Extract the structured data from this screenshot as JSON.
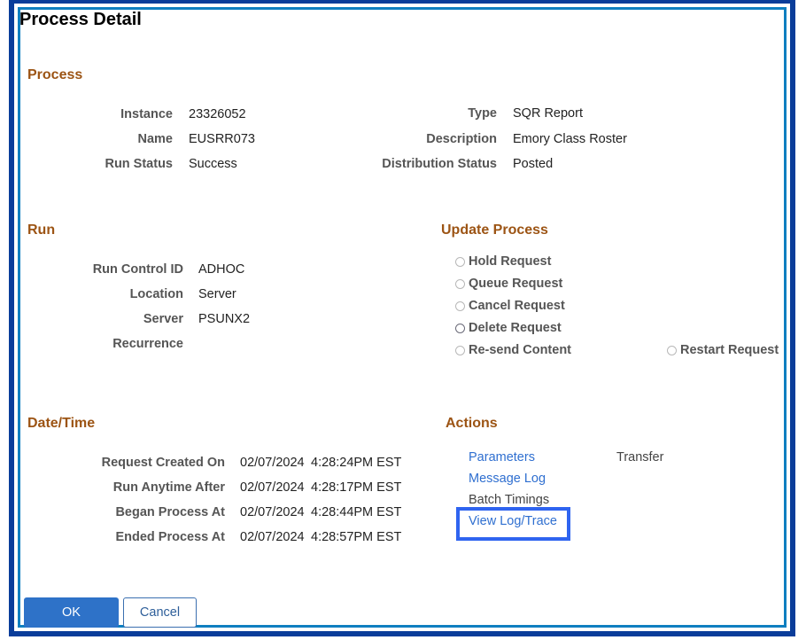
{
  "page": {
    "title": "Process Detail"
  },
  "process": {
    "heading": "Process",
    "fields": [
      {
        "label": "Instance",
        "value": "23326052"
      },
      {
        "label": "Name",
        "value": "EUSRR073"
      },
      {
        "label": "Run Status",
        "value": "Success"
      }
    ],
    "fields_right": [
      {
        "label": "Type",
        "value": "SQR Report"
      },
      {
        "label": "Description",
        "value": "Emory Class Roster"
      },
      {
        "label": "Distribution Status",
        "value": "Posted"
      }
    ]
  },
  "run": {
    "heading": "Run",
    "fields": [
      {
        "label": "Run Control ID",
        "value": "ADHOC"
      },
      {
        "label": "Location",
        "value": "Server"
      },
      {
        "label": "Server",
        "value": "PSUNX2"
      },
      {
        "label": "Recurrence",
        "value": ""
      }
    ]
  },
  "update_process": {
    "heading": "Update Process",
    "options": [
      {
        "label": "Hold Request",
        "selected": false,
        "enabled": false
      },
      {
        "label": "Queue Request",
        "selected": false,
        "enabled": false
      },
      {
        "label": "Cancel Request",
        "selected": false,
        "enabled": false
      },
      {
        "label": "Delete Request",
        "selected": false,
        "enabled": true
      },
      {
        "label": "Re-send Content",
        "selected": false,
        "enabled": false
      },
      {
        "label": "Restart Request",
        "selected": false,
        "enabled": false
      }
    ]
  },
  "datetime": {
    "heading": "Date/Time",
    "fields": [
      {
        "label": "Request Created On",
        "date": "02/07/2024",
        "time": "4:28:24PM EST"
      },
      {
        "label": "Run Anytime After",
        "date": "02/07/2024",
        "time": "4:28:17PM EST"
      },
      {
        "label": "Began Process At",
        "date": "02/07/2024",
        "time": "4:28:44PM EST"
      },
      {
        "label": "Ended Process At",
        "date": "02/07/2024",
        "time": "4:28:57PM EST"
      }
    ]
  },
  "actions": {
    "heading": "Actions",
    "items": [
      {
        "label": "Parameters",
        "link": true
      },
      {
        "label": "Transfer",
        "link": false
      },
      {
        "label": "Message Log",
        "link": true
      },
      {
        "label": "Batch Timings",
        "link": false
      },
      {
        "label": "View Log/Trace",
        "link": true,
        "focused": true
      }
    ],
    "focus_color": "#2f64f0"
  },
  "buttons": {
    "ok": "OK",
    "cancel": "Cancel"
  },
  "colors": {
    "section_heading": "#9c5414",
    "link": "#2f6fd0",
    "frame_outer": "#0a3d9a",
    "frame_inner": "#0f7fc0",
    "ok_button": "#2e72c8"
  }
}
